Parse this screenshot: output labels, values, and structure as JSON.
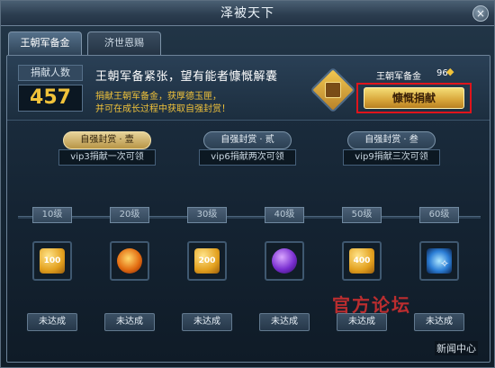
{
  "window": {
    "title": "泽被天下",
    "close_glyph": "×"
  },
  "tabs": [
    {
      "label": "王朝军备金",
      "active": true
    },
    {
      "label": "济世恩赐",
      "active": false
    }
  ],
  "donors": {
    "label": "捐献人数",
    "value": "457"
  },
  "headline": "王朝军备紧张，望有能者慷慨解囊",
  "description": [
    "捐献王朝军备金，获厚德玉匣，",
    "并可在成长过程中获取自强封赏！"
  ],
  "reserve": {
    "label": "王朝军备金",
    "value": "96",
    "icon": "gold-ingot-icon"
  },
  "donate_button": "慷慨捐献",
  "rewards": [
    {
      "title": "自强封赏 · 壹",
      "subtitle": "vip3捐献一次可领"
    },
    {
      "title": "自强封赏 · 贰",
      "subtitle": "vip6捐献两次可领"
    },
    {
      "title": "自强封赏 · 叁",
      "subtitle": "vip9捐献三次可领"
    }
  ],
  "levels": [
    {
      "label": "10级",
      "item": "gold-ingot-icon",
      "amount": "100",
      "status": "未达成"
    },
    {
      "label": "20级",
      "item": "fire-gem-icon",
      "amount": "",
      "status": "未达成"
    },
    {
      "label": "30级",
      "item": "gold-ingot-icon",
      "amount": "200",
      "status": "未达成"
    },
    {
      "label": "40级",
      "item": "purple-gem-icon",
      "amount": "",
      "status": "未达成"
    },
    {
      "label": "50级",
      "item": "gold-ingot-icon",
      "amount": "400",
      "status": "未达成"
    },
    {
      "label": "60级",
      "item": "blue-rune-icon",
      "amount": "",
      "status": "未达成"
    }
  ],
  "watermark": {
    "logo": "官方论坛",
    "news": "新闻中心"
  },
  "colors": {
    "gold": "#f0c23a",
    "highlight_red": "#e0141b"
  }
}
